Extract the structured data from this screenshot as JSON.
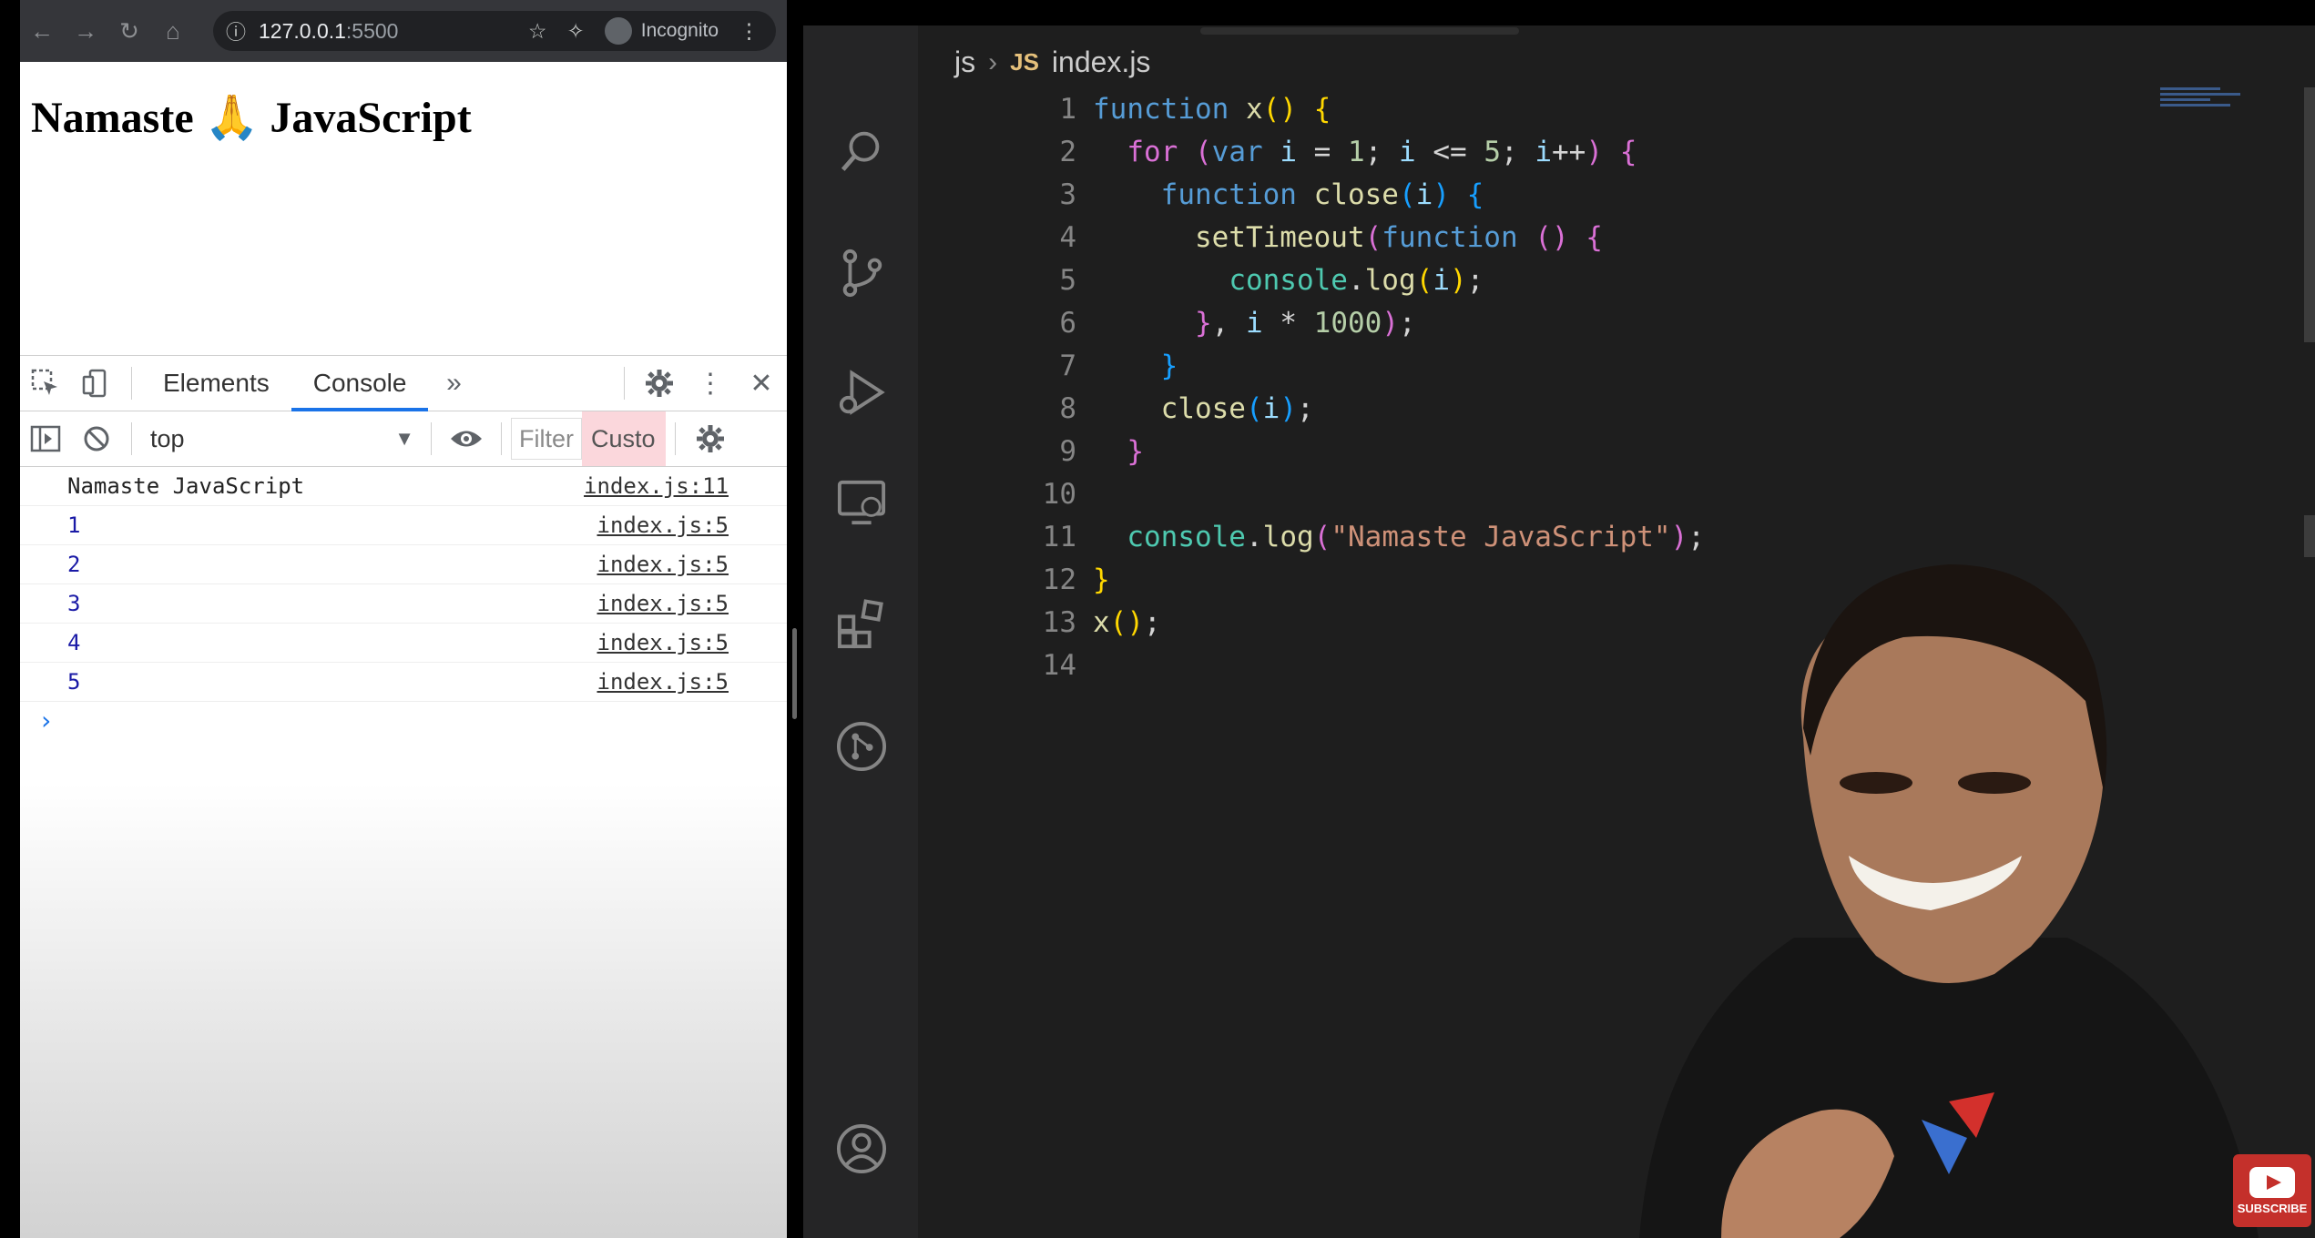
{
  "browser": {
    "url_host": "127.0.0.1",
    "url_port": ":5500",
    "incognito_label": "Incognito",
    "page_heading": "Namaste 🙏 JavaScript"
  },
  "devtools": {
    "tabs": [
      "Elements",
      "Console"
    ],
    "more_tabs_glyph": "»",
    "context": "top",
    "filter_placeholder": "Filter",
    "levels_label": "Custo",
    "console": [
      {
        "msg": "Namaste JavaScript",
        "src": "index.js:11"
      },
      {
        "msg": "1",
        "src": "index.js:5"
      },
      {
        "msg": "2",
        "src": "index.js:5"
      },
      {
        "msg": "3",
        "src": "index.js:5"
      },
      {
        "msg": "4",
        "src": "index.js:5"
      },
      {
        "msg": "5",
        "src": "index.js:5"
      }
    ],
    "prompt": "›"
  },
  "editor": {
    "breadcrumb_folder": "js",
    "breadcrumb_badge": "JS",
    "breadcrumb_file": "index.js",
    "line_numbers": [
      "1",
      "2",
      "3",
      "4",
      "5",
      "6",
      "7",
      "8",
      "9",
      "10",
      "11",
      "12",
      "13",
      "14"
    ]
  },
  "youtube": {
    "subscribe_label": "SUBSCRIBE"
  },
  "colors": {
    "editor_bg": "#1e1e1e",
    "activity_bar": "#252526",
    "chrome_bar": "#35363a",
    "devtools_accent": "#1a73e8"
  }
}
